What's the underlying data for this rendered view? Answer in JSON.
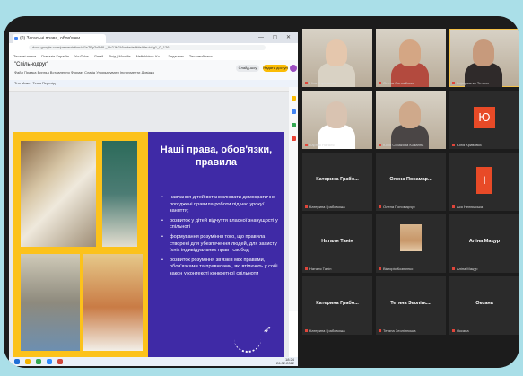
{
  "browser": {
    "tab_title": "(0) Загальні права, обов'язки...",
    "window_controls": "— ▢ ✕",
    "url": "docs.google.com/presentation/d/1s7Ey2x5WL_Xh2JkGVhadw/edit#slide=id.g1_0_126",
    "bookmarks": [
      "Тестові папки",
      "Гімназія Карабін",
      "YouTube",
      "Gmail",
      "Вхід | Moodle",
      "Neftekhim · Ко...",
      "Задачник",
      "Тестовий тест ..."
    ]
  },
  "doc": {
    "title": "\"Спільнодруг\"",
    "menus": "Файл  Правка  Вигляд  Вставлення  Формат  Слайд  Упорядкувати  Інструменти  Довідка",
    "present_label": "Слайд-шоу",
    "share_label": "Надати доступ",
    "toolbar": "Тло  Макет  Тема  Перехід"
  },
  "slide": {
    "title": "Наші права, обов'язки, правила",
    "bullets": [
      "навчання дітей встановлювати демократично погоджені правила роботи під час уроку/заняття;",
      "розвиток у дітей відчуття власної значущості у спільноті",
      "формування розуміння того, що правила створені для убезпечення людей, для захисту їхніх індивідуальних прав і свобод",
      "розвиток розуміння зв'язків між правами, обов'язками та правилами, які втілюють у собі закон у контексті конкретної спільноти"
    ],
    "arrow_glyph": "➶",
    "colors": {
      "background": "#fcc21b",
      "panel": "#3f2aa6"
    }
  },
  "taskbar": {
    "time": "18:24",
    "date": "26.02.2022"
  },
  "participants": [
    {
      "name": "Ніна Стрільчева",
      "type": "video",
      "face": "#e5c7ad",
      "torso": "#d9d2c4"
    },
    {
      "name": "Олена Соловйова",
      "type": "video",
      "face": "#d4a684",
      "torso": "#b34a3e"
    },
    {
      "name": "Інформатик Тетяна",
      "type": "video",
      "face": "#c79a7c",
      "torso": "#2f2a2a",
      "speaking": true
    },
    {
      "name": "Карпяк Наталя",
      "type": "video",
      "face": "#d9c3b1",
      "torso": "#ffffff"
    },
    {
      "name": "Юлія Собакова Юліанна",
      "type": "video",
      "face": "#cfa98b",
      "torso": "#4a4545"
    },
    {
      "name": "Юлія Кривовяз",
      "type": "initial",
      "initial": "Ю"
    },
    {
      "name": "Катерина Грабовська",
      "type": "name",
      "big": "Катерина Грабо..."
    },
    {
      "name": "Олена Пономарчук",
      "type": "name",
      "big": "Олена Понамар..."
    },
    {
      "name": "Ася Нелюмська",
      "type": "initial2",
      "initial": "І"
    },
    {
      "name": "Наталя Танін",
      "type": "name",
      "big": "Наталя Танін"
    },
    {
      "name": "Вікторія Козюєнко",
      "type": "photo"
    },
    {
      "name": "Аліна Мацур",
      "type": "name",
      "big": "Аліна Мацур"
    },
    {
      "name": "Катерина Грабовська",
      "type": "name",
      "big": "Катерина Грабо..."
    },
    {
      "name": "Тетяна Зеоліннська",
      "type": "name",
      "big": "Тетяна Зеолінс..."
    },
    {
      "name": "Оксана",
      "type": "name",
      "big": "Оксана"
    }
  ]
}
